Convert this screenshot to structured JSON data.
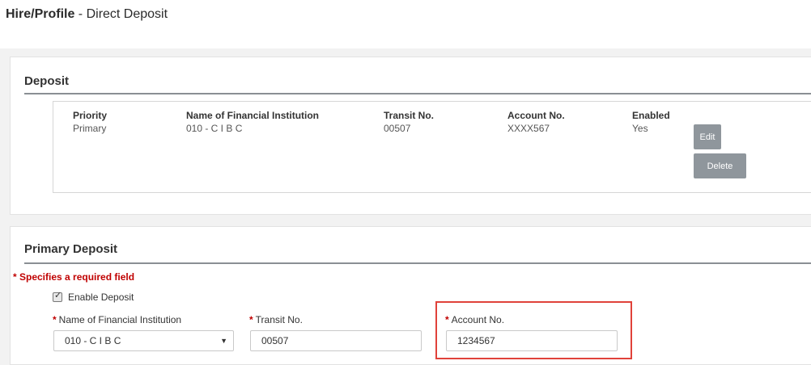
{
  "page": {
    "title_main": "Hire/Profile",
    "title_sub": " - Direct Deposit"
  },
  "deposit_section": {
    "title": "Deposit",
    "columns": {
      "priority": "Priority",
      "institution": "Name of Financial Institution",
      "transit": "Transit No.",
      "account": "Account No.",
      "enabled": "Enabled"
    },
    "row": {
      "priority": "Primary",
      "institution": "010 - C I B C",
      "transit": "00507",
      "account": "XXXX567",
      "enabled": "Yes"
    },
    "edit_label": "Edit",
    "delete_label": "Delete"
  },
  "primary_section": {
    "title": "Primary Deposit",
    "required_note": "* Specifies a required field",
    "enable_label": "Enable Deposit",
    "enable_checked": true,
    "required_star": "*",
    "institution_label": "Name of Financial Institution",
    "institution_value": "010 - C I B C",
    "transit_label": "Transit No.",
    "transit_value": "00507",
    "account_label": "Account No.",
    "account_value": "1234567"
  },
  "colors": {
    "required": "#c00000",
    "button": "#8f969c",
    "highlight": "#e0423a"
  }
}
